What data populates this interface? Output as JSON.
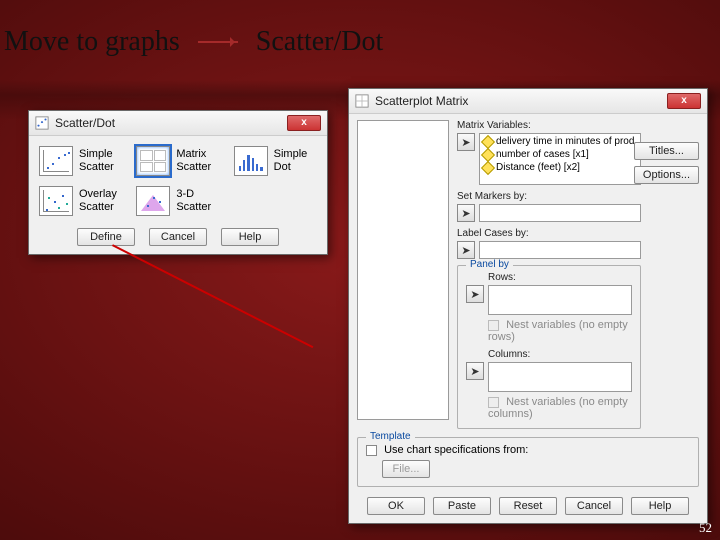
{
  "slide": {
    "title_left": "Move to graphs",
    "title_right": "Scatter/Dot",
    "page_number": "52"
  },
  "scatter_dialog": {
    "title": "Scatter/Dot",
    "options": {
      "simple_scatter": "Simple\nScatter",
      "matrix_scatter": "Matrix\nScatter",
      "simple_dot": "Simple\nDot",
      "overlay_scatter": "Overlay\nScatter",
      "three_d_scatter": "3-D\nScatter"
    },
    "buttons": {
      "define": "Define",
      "cancel": "Cancel",
      "help": "Help"
    },
    "close_x": "x"
  },
  "matrix_dialog": {
    "title": "Scatterplot Matrix",
    "labels": {
      "matrix_variables": "Matrix Variables:",
      "set_markers": "Set Markers by:",
      "label_cases": "Label Cases by:",
      "panel": "Panel by",
      "rows": "Rows:",
      "nest_rows": "Nest variables (no empty rows)",
      "columns": "Columns:",
      "nest_cols": "Nest variables (no empty columns)",
      "template": "Template",
      "use_spec": "Use chart specifications from:",
      "file": "File..."
    },
    "matrix_vars": [
      "delivery time in minutes of prod",
      "number of cases [x1]",
      "Distance (feet) [x2]"
    ],
    "side_buttons": {
      "titles": "Titles...",
      "options": "Options..."
    },
    "bottom_buttons": {
      "ok": "OK",
      "paste": "Paste",
      "reset": "Reset",
      "cancel": "Cancel",
      "help": "Help"
    },
    "close_x": "x"
  }
}
